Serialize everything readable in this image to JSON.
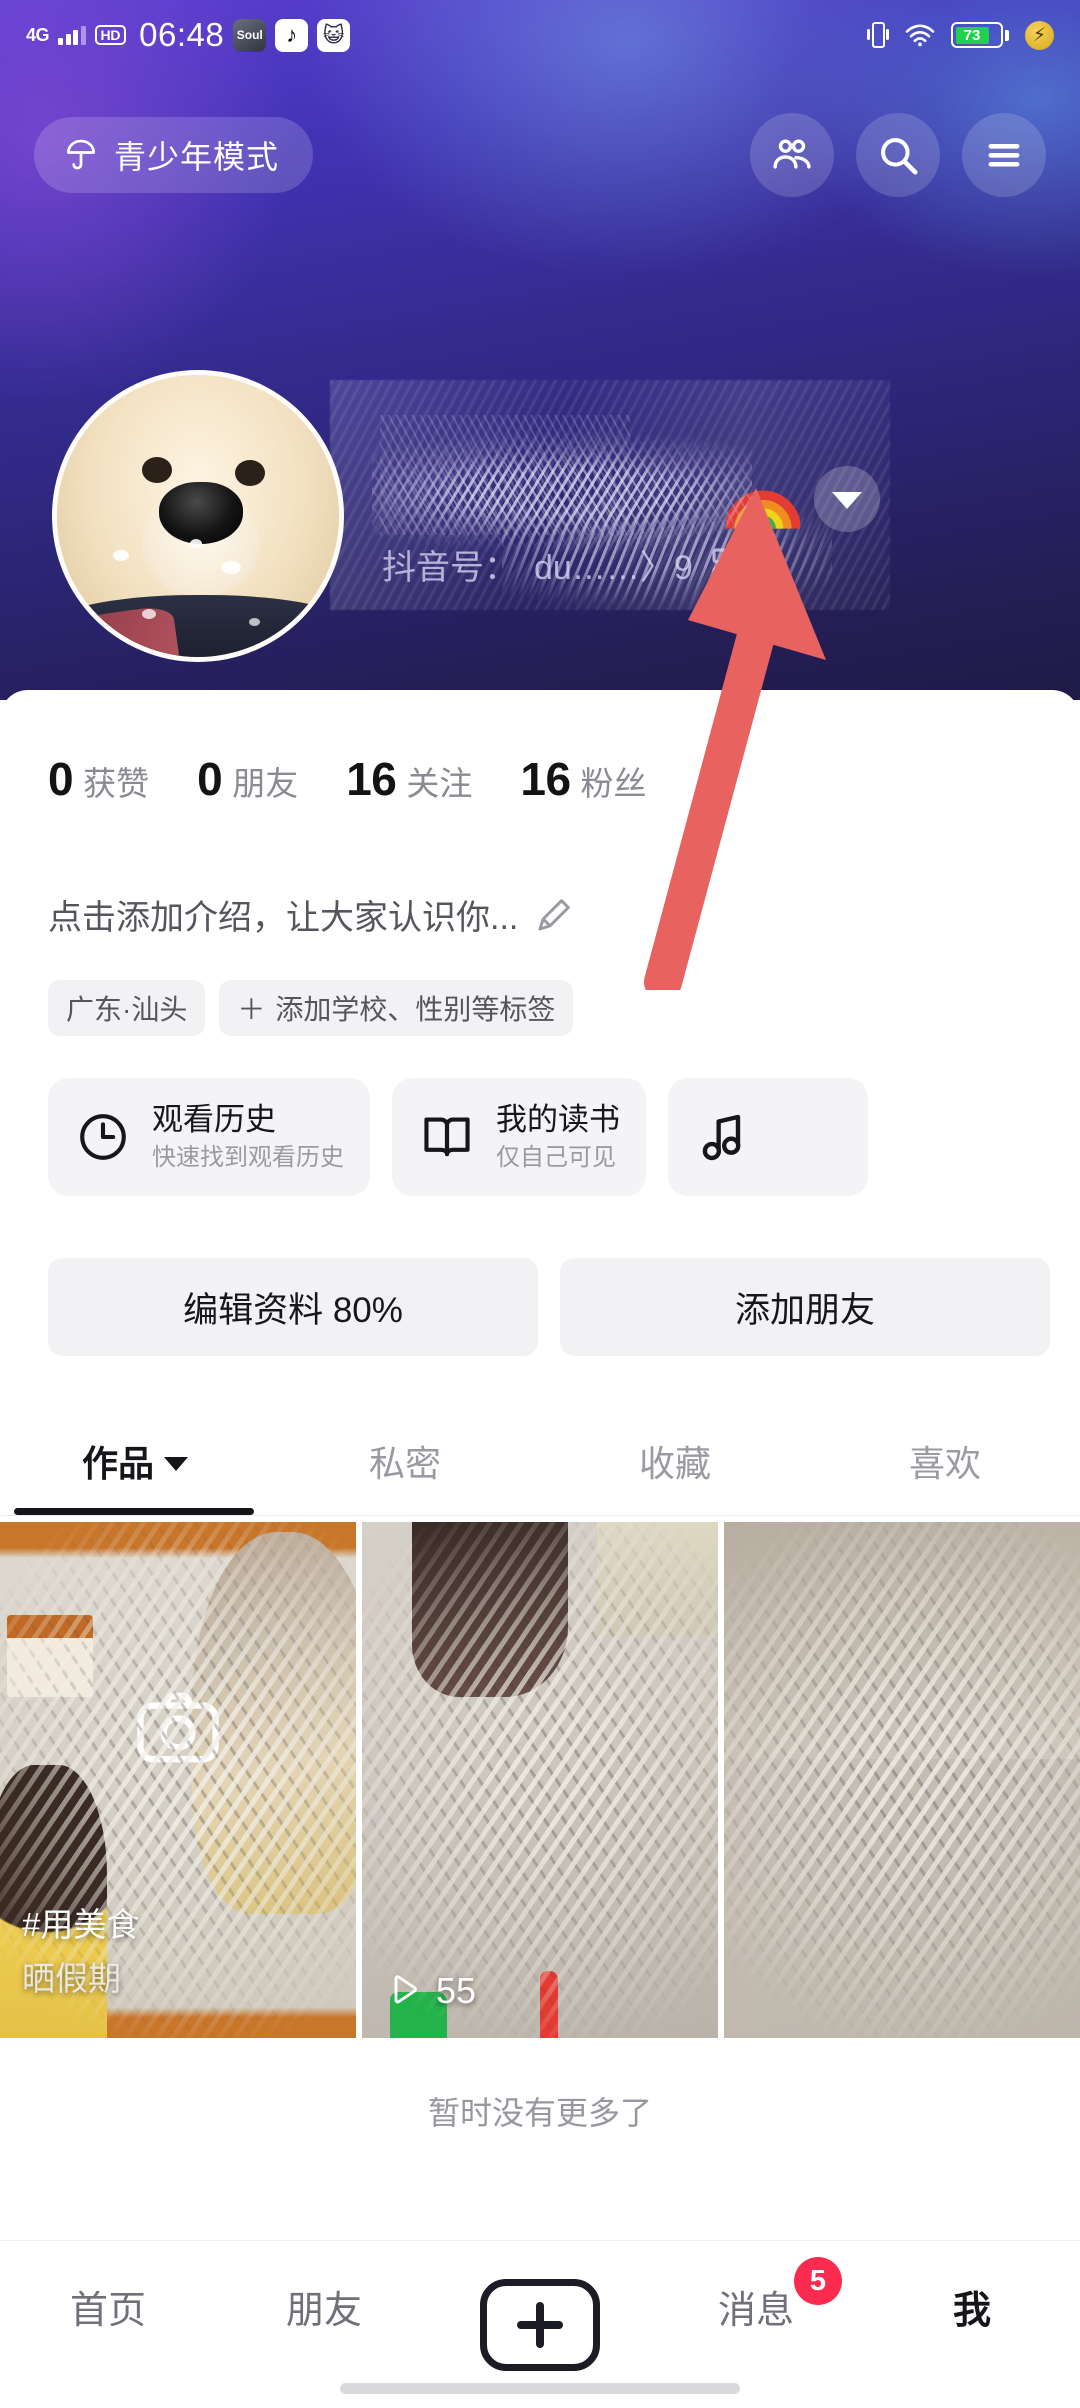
{
  "status_bar": {
    "network": "4G",
    "hd": "HD",
    "time": "06:48",
    "app_icons": [
      "soul-app-icon",
      "douyin-app-icon",
      "cat-app-icon"
    ],
    "vibrate_icon": "vibrate-icon",
    "wifi_icon": "wifi-icon",
    "battery_level": "73",
    "charging_icon": "charging-bolt-icon",
    "soul_label": "Soul",
    "douyin_glyph": "♪",
    "cat_glyph": "😺"
  },
  "top_bar": {
    "teen_mode_label": "青少年模式",
    "teen_mode_icon": "umbrella-icon",
    "add_friends_icon": "add-friends-icon",
    "search_icon": "search-icon",
    "menu_icon": "hamburger-menu-icon"
  },
  "profile": {
    "avatar_alt": "golden-retriever-puppy-avatar",
    "display_name": "",
    "name_redacted": true,
    "rainbow_emoji": "🌈",
    "expand_icon": "chevron-down-icon",
    "douyin_id_label": "抖音号：",
    "douyin_id_value": "du……〉9",
    "qr_icon": "qr-code-icon"
  },
  "stats": [
    {
      "num": "0",
      "label": "获赞"
    },
    {
      "num": "0",
      "label": "朋友"
    },
    {
      "num": "16",
      "label": "关注"
    },
    {
      "num": "16",
      "label": "粉丝"
    }
  ],
  "bio": {
    "placeholder": "点击添加介绍，让大家认识你...",
    "edit_icon": "pencil-edit-icon"
  },
  "tags": [
    {
      "label": "广东·汕头",
      "has_plus": false
    },
    {
      "label": "添加学校、性别等标签",
      "has_plus": true,
      "plus": "＋"
    }
  ],
  "cards": [
    {
      "icon": "clock-icon",
      "title": "观看历史",
      "subtitle": "快速找到观看历史"
    },
    {
      "icon": "book-icon",
      "title": "我的读书",
      "subtitle": "仅自己可见"
    },
    {
      "icon": "music-note-icon",
      "title": "",
      "subtitle": ""
    }
  ],
  "actions": [
    {
      "label": "编辑资料 80%",
      "name": "edit-profile-button"
    },
    {
      "label": "添加朋友",
      "name": "add-friend-button"
    }
  ],
  "tabs": [
    {
      "label": "作品",
      "active": true,
      "has_caret": true
    },
    {
      "label": "私密",
      "active": false,
      "has_caret": false
    },
    {
      "label": "收藏",
      "active": false,
      "has_caret": false
    },
    {
      "label": "喜欢",
      "active": false,
      "has_caret": false
    }
  ],
  "videos": [
    {
      "overlay_icon": "camera-icon",
      "caption_line1": "#用美食",
      "caption_line2": "晒假期",
      "play_count": ""
    },
    {
      "overlay_icon": "",
      "caption_line1": "",
      "caption_line2": "",
      "play_count": "55",
      "play_icon": "play-icon"
    },
    {
      "overlay_icon": "",
      "caption_line1": "",
      "caption_line2": "",
      "play_count": ""
    }
  ],
  "footer": {
    "no_more_text": "暂时没有更多了"
  },
  "bottom_nav": [
    {
      "label": "首页",
      "active": false,
      "name": "nav-home"
    },
    {
      "label": "朋友",
      "active": false,
      "name": "nav-friends"
    },
    {
      "label": "",
      "active": false,
      "name": "nav-create"
    },
    {
      "label": "消息",
      "active": false,
      "name": "nav-messages",
      "badge": "5"
    },
    {
      "label": "我",
      "active": true,
      "name": "nav-me"
    }
  ],
  "annotation": {
    "arrow_color": "#e8635f",
    "points_to": "chevron-down-icon"
  },
  "colors": {
    "accent_red": "#fa2b4f",
    "battery_green": "#1fd14b",
    "cover_purple": "#4233b5",
    "text_dark": "#15151a",
    "text_muted": "#9a9aa2",
    "chip_bg": "#f2f2f4"
  }
}
